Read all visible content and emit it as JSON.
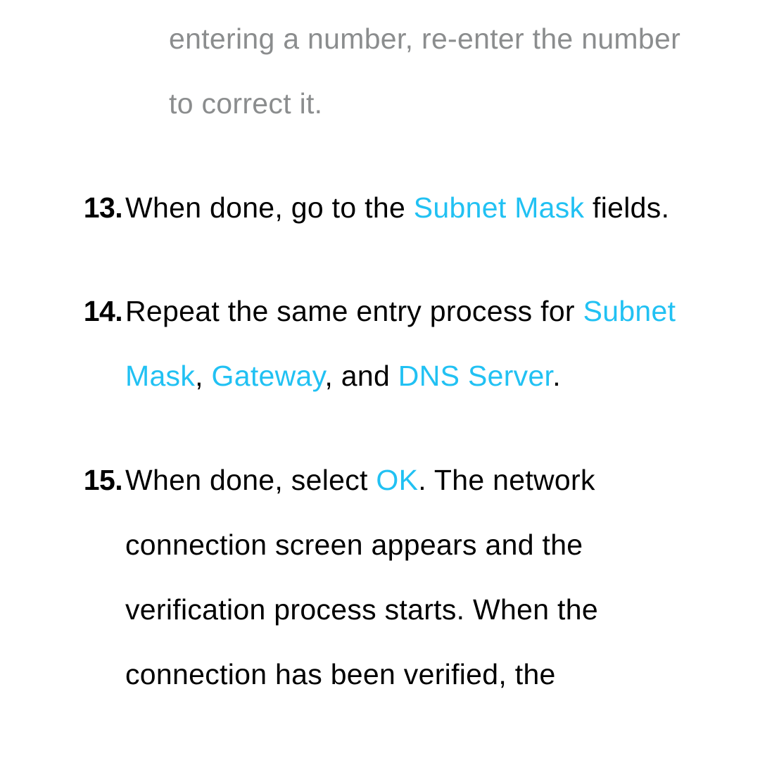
{
  "intro": {
    "text_part1": "entering a number, re-enter the number to correct it."
  },
  "steps": [
    {
      "number": "13.",
      "segments": [
        {
          "text": "When done, go to the ",
          "kw": false
        },
        {
          "text": "Subnet Mask",
          "kw": true
        },
        {
          "text": " fields.",
          "kw": false
        }
      ]
    },
    {
      "number": "14.",
      "segments": [
        {
          "text": "Repeat the same entry process for ",
          "kw": false
        },
        {
          "text": "Subnet Mask",
          "kw": true
        },
        {
          "text": ", ",
          "kw": false
        },
        {
          "text": "Gateway",
          "kw": true
        },
        {
          "text": ", and ",
          "kw": false
        },
        {
          "text": "DNS Server",
          "kw": true
        },
        {
          "text": ".",
          "kw": false
        }
      ]
    },
    {
      "number": "15.",
      "segments": [
        {
          "text": "When done, select ",
          "kw": false
        },
        {
          "text": "OK",
          "kw": true
        },
        {
          "text": ". The network connection screen appears and the verification process starts. When the connection has been verified, the",
          "kw": false
        }
      ]
    }
  ]
}
